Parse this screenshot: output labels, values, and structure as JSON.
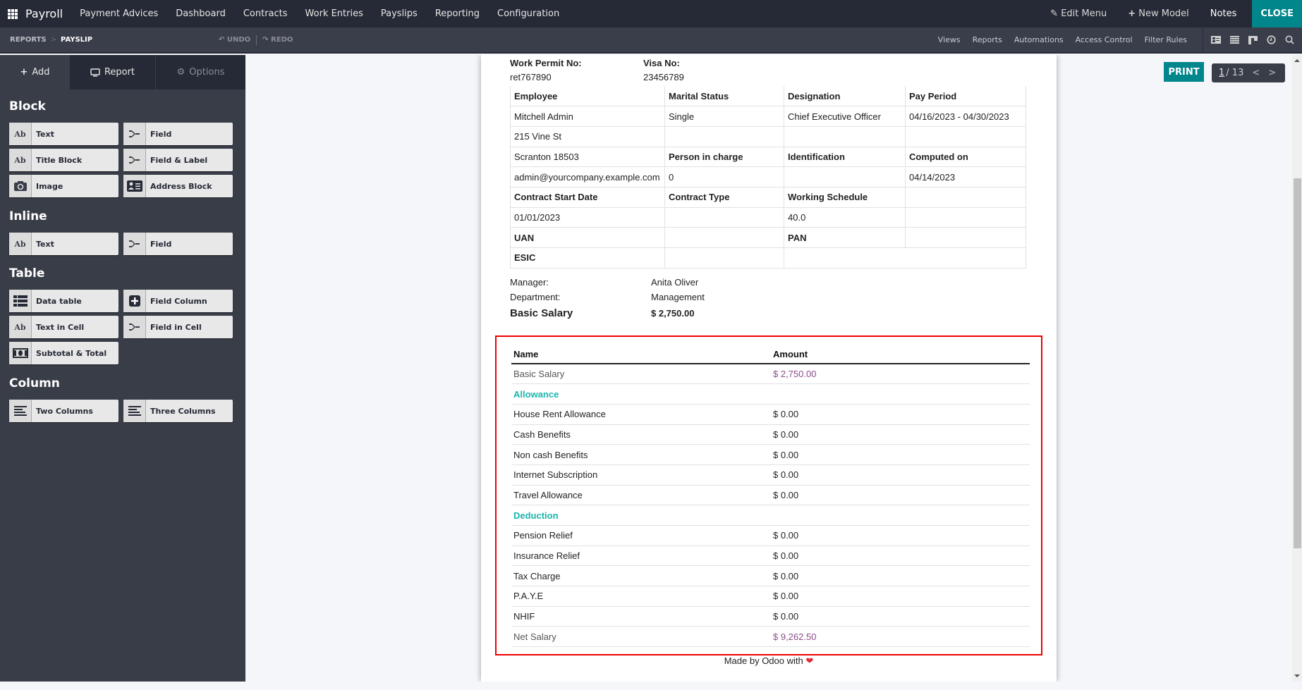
{
  "topnav": {
    "app_name": "Payroll",
    "menu": [
      "Payment Advices",
      "Dashboard",
      "Contracts",
      "Work Entries",
      "Payslips",
      "Reporting",
      "Configuration"
    ],
    "edit_menu": "Edit Menu",
    "new_model": "New Model",
    "notes": "Notes",
    "close": "CLOSE"
  },
  "subbar": {
    "breadcrumb": [
      "REPORTS",
      "PAYSLIP"
    ],
    "undo": "UNDO",
    "redo": "REDO",
    "links": [
      "Views",
      "Reports",
      "Automations",
      "Access Control",
      "Filter Rules"
    ],
    "view_icons": [
      "form-view-icon",
      "list-view-icon",
      "kanban-view-icon",
      "activity-view-icon",
      "search-icon"
    ]
  },
  "sidebar": {
    "tabs": [
      {
        "label": "Add",
        "icon": "plus-icon",
        "active": true
      },
      {
        "label": "Report",
        "icon": "monitor-icon",
        "active": false
      },
      {
        "label": "Options",
        "icon": "gear-icon",
        "active": false
      }
    ],
    "sections": [
      {
        "title": "Block",
        "items": [
          {
            "label": "Text",
            "icon": "text-icon"
          },
          {
            "label": "Field",
            "icon": "field-icon"
          },
          {
            "label": "Title Block",
            "icon": "text-icon"
          },
          {
            "label": "Field & Label",
            "icon": "field-icon"
          },
          {
            "label": "Image",
            "icon": "camera-icon"
          },
          {
            "label": "Address Block",
            "icon": "address-card-icon"
          }
        ]
      },
      {
        "title": "Inline",
        "items": [
          {
            "label": "Text",
            "icon": "text-icon"
          },
          {
            "label": "Field",
            "icon": "field-icon"
          }
        ]
      },
      {
        "title": "Table",
        "items": [
          {
            "label": "Data table",
            "icon": "list-icon"
          },
          {
            "label": "Field Column",
            "icon": "plus-square-icon"
          },
          {
            "label": "Text in Cell",
            "icon": "text-icon"
          },
          {
            "label": "Field in Cell",
            "icon": "field-icon"
          },
          {
            "label": "Subtotal & Total",
            "icon": "money-icon"
          }
        ]
      },
      {
        "title": "Column",
        "items": [
          {
            "label": "Two Columns",
            "icon": "align-left-icon"
          },
          {
            "label": "Three Columns",
            "icon": "align-left-icon"
          }
        ]
      }
    ]
  },
  "toolbar": {
    "print": "PRINT",
    "pager_current": "1",
    "pager_total": "/ 13"
  },
  "doc": {
    "work_permit_label": "Work Permit No:",
    "work_permit_value": "ret767890",
    "visa_label": "Visa No:",
    "visa_value": "23456789",
    "info_rows": [
      [
        {
          "t": "Employee",
          "b": true
        },
        {
          "t": "Marital Status",
          "b": true
        },
        {
          "t": "Designation",
          "b": true
        },
        {
          "t": "Pay Period",
          "b": true
        }
      ],
      [
        {
          "t": "Mitchell Admin"
        },
        {
          "t": "Single"
        },
        {
          "t": "Chief Executive Officer"
        },
        {
          "t": "04/16/2023 - 04/30/2023"
        }
      ],
      [
        {
          "t": "215 Vine St"
        },
        {
          "t": ""
        },
        {
          "t": ""
        },
        {
          "t": ""
        }
      ],
      [
        {
          "t": "Scranton 18503"
        },
        {
          "t": "Person in charge",
          "b": true
        },
        {
          "t": "Identification",
          "b": true
        },
        {
          "t": "Computed on",
          "b": true
        }
      ],
      [
        {
          "t": "admin@yourcompany.example.com"
        },
        {
          "t": "0"
        },
        {
          "t": ""
        },
        {
          "t": "04/14/2023"
        }
      ],
      [
        {
          "t": "Contract Start Date",
          "b": true
        },
        {
          "t": "Contract Type",
          "b": true
        },
        {
          "t": "Working Schedule",
          "b": true
        },
        {
          "t": ""
        }
      ],
      [
        {
          "t": "01/01/2023"
        },
        {
          "t": ""
        },
        {
          "t": "40.0"
        },
        {
          "t": ""
        }
      ],
      [
        {
          "t": "UAN",
          "b": true
        },
        {
          "t": ""
        },
        {
          "t": "PAN",
          "b": true
        },
        {
          "t": ""
        }
      ],
      [
        {
          "t": "ESIC",
          "b": true
        },
        {
          "t": ""
        },
        {
          "t": "",
          "span": 2
        }
      ]
    ],
    "manager_label": "Manager:",
    "manager_value": "Anita Oliver",
    "department_label": "Department:",
    "department_value": "Management",
    "basic_salary_label": "Basic Salary",
    "basic_salary_value": "$ 2,750.00",
    "salary_table": {
      "headers": [
        "Name",
        "Amount"
      ],
      "rows": [
        {
          "name": "Basic Salary",
          "amount": "$ 2,750.00",
          "type": "summary"
        },
        {
          "name": "Allowance",
          "amount": "",
          "type": "section"
        },
        {
          "name": "House Rent Allowance",
          "amount": "$ 0.00",
          "type": "line"
        },
        {
          "name": "Cash Benefits",
          "amount": "$ 0.00",
          "type": "line"
        },
        {
          "name": "Non cash Benefits",
          "amount": "$ 0.00",
          "type": "line"
        },
        {
          "name": "Internet Subscription",
          "amount": "$ 0.00",
          "type": "line"
        },
        {
          "name": "Travel Allowance",
          "amount": "$ 0.00",
          "type": "line"
        },
        {
          "name": "Deduction",
          "amount": "",
          "type": "section"
        },
        {
          "name": "Pension Relief",
          "amount": "$ 0.00",
          "type": "line"
        },
        {
          "name": "Insurance Relief",
          "amount": "$ 0.00",
          "type": "line"
        },
        {
          "name": "Tax Charge",
          "amount": "$ 0.00",
          "type": "line"
        },
        {
          "name": "P.A.Y.E",
          "amount": "$ 0.00",
          "type": "line"
        },
        {
          "name": "NHIF",
          "amount": "$ 0.00",
          "type": "line"
        },
        {
          "name": "Net Salary",
          "amount": "$ 9,262.50",
          "type": "summary"
        }
      ]
    },
    "footer_text": "Made by Odoo with",
    "footer_heart": "❤"
  },
  "colors": {
    "accent": "#00868b",
    "section_text": "#17b6ad",
    "summary_amount": "#8b4c8a",
    "highlight_border": "#ee0000"
  }
}
